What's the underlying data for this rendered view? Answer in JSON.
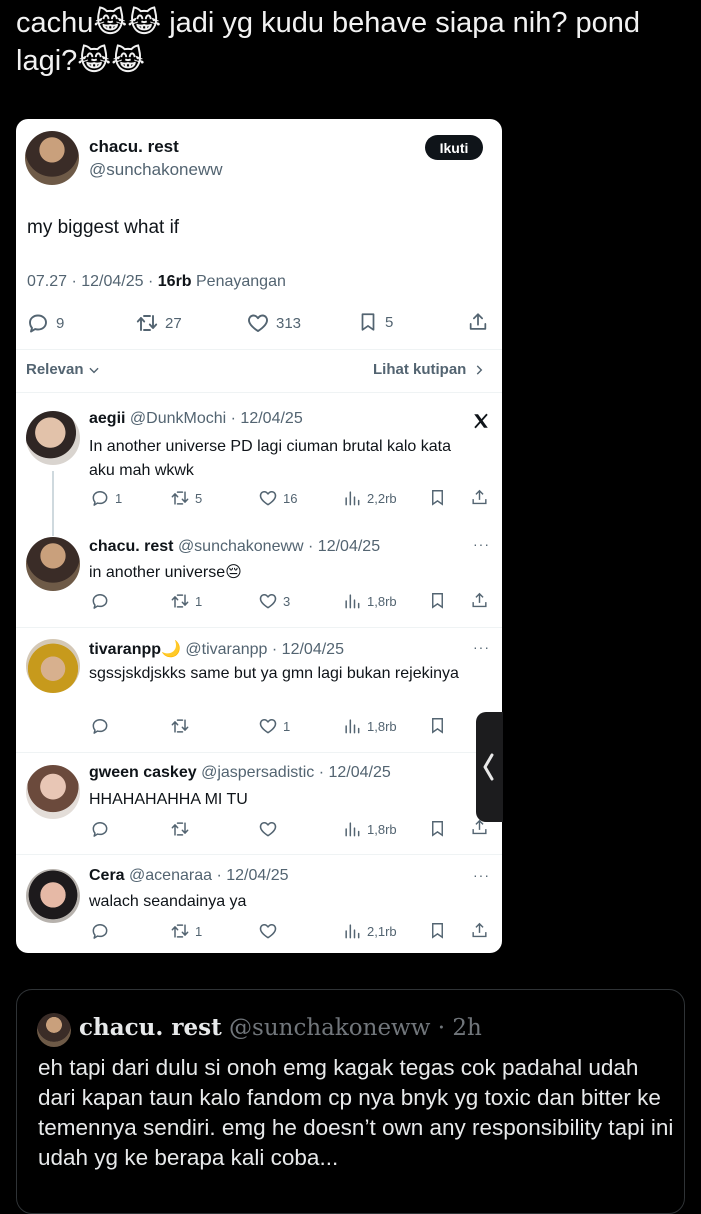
{
  "post": {
    "text": "cachu😹😹 jadi yg kudu behave siapa nih? pond lagi?😹😹"
  },
  "screenshot": {
    "author": {
      "name": "chacu. rest",
      "handle": "@sunchakoneww"
    },
    "follow_label": "Ikuti",
    "tweet_text": "my biggest what if",
    "meta": {
      "time_date": "07.27 · 12/04/25 · ",
      "views_count": "16rb",
      "views_label": " Penayangan"
    },
    "actions": {
      "replies": "9",
      "retweets": "27",
      "likes": "313",
      "bookmarks": "5"
    },
    "sort_label": "Relevan",
    "quotes_label": "Lihat kutipan",
    "replies": [
      {
        "name": "aegii",
        "handle": "@DunkMochi",
        "date": "· 12/04/25",
        "text": "In another universe PD lagi ciuman brutal kalo kata aku mah wkwk",
        "reply_count": "1",
        "retweet_count": "5",
        "like_count": "16",
        "view_count": "2,2rb"
      },
      {
        "name": "chacu. rest",
        "handle": "@sunchakoneww",
        "date": "· 12/04/25",
        "text": "in another universe😔",
        "reply_count": "",
        "retweet_count": "1",
        "like_count": "3",
        "view_count": "1,8rb"
      },
      {
        "name": "tivaranpp🌙",
        "handle": "@tivaranpp",
        "date": "· 12/04/25",
        "text": "sgssjskdjskks same but ya gmn lagi bukan rejekinya",
        "reply_count": "",
        "retweet_count": "",
        "like_count": "1",
        "view_count": "1,8rb"
      },
      {
        "name": "gween caskey",
        "handle": "@jaspersadistic",
        "date": "· 12/04/25",
        "text": "HHAHAHAHHA MI TU",
        "reply_count": "",
        "retweet_count": "",
        "like_count": "",
        "view_count": "1,8rb"
      },
      {
        "name": "Cera",
        "handle": "@acenaraa",
        "date": "· 12/04/25",
        "text": "walach seandainya ya",
        "reply_count": "",
        "retweet_count": "1",
        "like_count": "",
        "view_count": "2,1rb"
      }
    ]
  },
  "quoted": {
    "name": "chacu. rest",
    "handle": "@sunchakoneww",
    "time": "· 2h",
    "text": "eh tapi dari dulu si onoh emg kagak tegas cok padahal udah dari kapan taun kalo fandom cp nya bnyk yg toxic dan bitter ke temennya sendiri. emg he doesn’t own any responsibility tapi ini udah yg ke berapa kali coba..."
  },
  "colors": {
    "accent_dark": "#0f1419",
    "muted": "#536471",
    "border": "#2f3336",
    "background": "#000000"
  },
  "icons": [
    "x-logo-icon",
    "reply-icon",
    "retweet-icon",
    "like-icon",
    "views-icon",
    "bookmark-icon",
    "share-icon",
    "more-icon",
    "chevron-down-icon",
    "chevron-right-icon",
    "chevron-left-icon"
  ]
}
